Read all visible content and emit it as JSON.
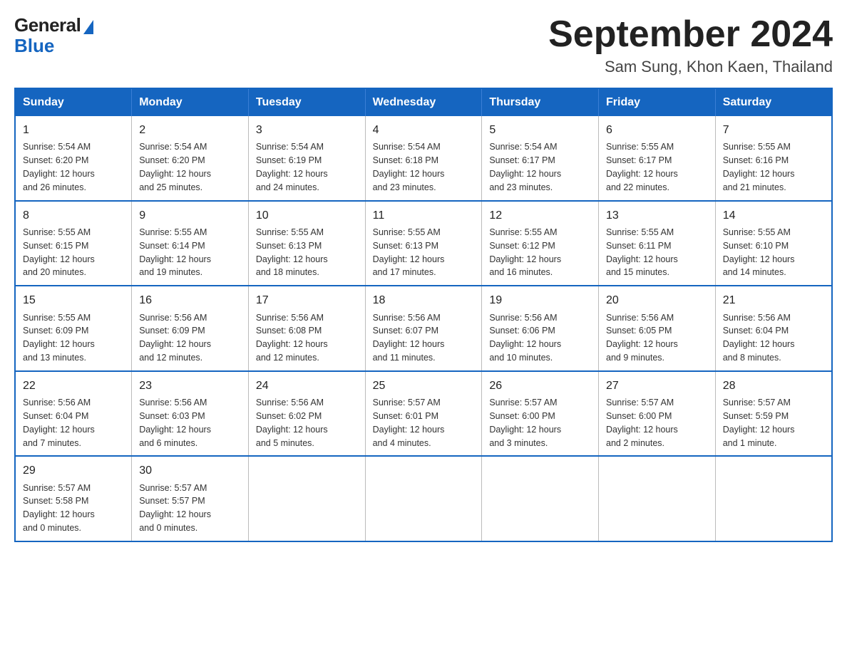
{
  "logo": {
    "general": "General",
    "blue": "Blue"
  },
  "title": "September 2024",
  "subtitle": "Sam Sung, Khon Kaen, Thailand",
  "headers": [
    "Sunday",
    "Monday",
    "Tuesday",
    "Wednesday",
    "Thursday",
    "Friday",
    "Saturday"
  ],
  "weeks": [
    [
      {
        "day": "1",
        "sunrise": "5:54 AM",
        "sunset": "6:20 PM",
        "daylight": "12 hours and 26 minutes."
      },
      {
        "day": "2",
        "sunrise": "5:54 AM",
        "sunset": "6:20 PM",
        "daylight": "12 hours and 25 minutes."
      },
      {
        "day": "3",
        "sunrise": "5:54 AM",
        "sunset": "6:19 PM",
        "daylight": "12 hours and 24 minutes."
      },
      {
        "day": "4",
        "sunrise": "5:54 AM",
        "sunset": "6:18 PM",
        "daylight": "12 hours and 23 minutes."
      },
      {
        "day": "5",
        "sunrise": "5:54 AM",
        "sunset": "6:17 PM",
        "daylight": "12 hours and 23 minutes."
      },
      {
        "day": "6",
        "sunrise": "5:55 AM",
        "sunset": "6:17 PM",
        "daylight": "12 hours and 22 minutes."
      },
      {
        "day": "7",
        "sunrise": "5:55 AM",
        "sunset": "6:16 PM",
        "daylight": "12 hours and 21 minutes."
      }
    ],
    [
      {
        "day": "8",
        "sunrise": "5:55 AM",
        "sunset": "6:15 PM",
        "daylight": "12 hours and 20 minutes."
      },
      {
        "day": "9",
        "sunrise": "5:55 AM",
        "sunset": "6:14 PM",
        "daylight": "12 hours and 19 minutes."
      },
      {
        "day": "10",
        "sunrise": "5:55 AM",
        "sunset": "6:13 PM",
        "daylight": "12 hours and 18 minutes."
      },
      {
        "day": "11",
        "sunrise": "5:55 AM",
        "sunset": "6:13 PM",
        "daylight": "12 hours and 17 minutes."
      },
      {
        "day": "12",
        "sunrise": "5:55 AM",
        "sunset": "6:12 PM",
        "daylight": "12 hours and 16 minutes."
      },
      {
        "day": "13",
        "sunrise": "5:55 AM",
        "sunset": "6:11 PM",
        "daylight": "12 hours and 15 minutes."
      },
      {
        "day": "14",
        "sunrise": "5:55 AM",
        "sunset": "6:10 PM",
        "daylight": "12 hours and 14 minutes."
      }
    ],
    [
      {
        "day": "15",
        "sunrise": "5:55 AM",
        "sunset": "6:09 PM",
        "daylight": "12 hours and 13 minutes."
      },
      {
        "day": "16",
        "sunrise": "5:56 AM",
        "sunset": "6:09 PM",
        "daylight": "12 hours and 12 minutes."
      },
      {
        "day": "17",
        "sunrise": "5:56 AM",
        "sunset": "6:08 PM",
        "daylight": "12 hours and 12 minutes."
      },
      {
        "day": "18",
        "sunrise": "5:56 AM",
        "sunset": "6:07 PM",
        "daylight": "12 hours and 11 minutes."
      },
      {
        "day": "19",
        "sunrise": "5:56 AM",
        "sunset": "6:06 PM",
        "daylight": "12 hours and 10 minutes."
      },
      {
        "day": "20",
        "sunrise": "5:56 AM",
        "sunset": "6:05 PM",
        "daylight": "12 hours and 9 minutes."
      },
      {
        "day": "21",
        "sunrise": "5:56 AM",
        "sunset": "6:04 PM",
        "daylight": "12 hours and 8 minutes."
      }
    ],
    [
      {
        "day": "22",
        "sunrise": "5:56 AM",
        "sunset": "6:04 PM",
        "daylight": "12 hours and 7 minutes."
      },
      {
        "day": "23",
        "sunrise": "5:56 AM",
        "sunset": "6:03 PM",
        "daylight": "12 hours and 6 minutes."
      },
      {
        "day": "24",
        "sunrise": "5:56 AM",
        "sunset": "6:02 PM",
        "daylight": "12 hours and 5 minutes."
      },
      {
        "day": "25",
        "sunrise": "5:57 AM",
        "sunset": "6:01 PM",
        "daylight": "12 hours and 4 minutes."
      },
      {
        "day": "26",
        "sunrise": "5:57 AM",
        "sunset": "6:00 PM",
        "daylight": "12 hours and 3 minutes."
      },
      {
        "day": "27",
        "sunrise": "5:57 AM",
        "sunset": "6:00 PM",
        "daylight": "12 hours and 2 minutes."
      },
      {
        "day": "28",
        "sunrise": "5:57 AM",
        "sunset": "5:59 PM",
        "daylight": "12 hours and 1 minute."
      }
    ],
    [
      {
        "day": "29",
        "sunrise": "5:57 AM",
        "sunset": "5:58 PM",
        "daylight": "12 hours and 0 minutes."
      },
      {
        "day": "30",
        "sunrise": "5:57 AM",
        "sunset": "5:57 PM",
        "daylight": "12 hours and 0 minutes."
      },
      null,
      null,
      null,
      null,
      null
    ]
  ],
  "labels": {
    "sunrise": "Sunrise:",
    "sunset": "Sunset:",
    "daylight": "Daylight:"
  }
}
